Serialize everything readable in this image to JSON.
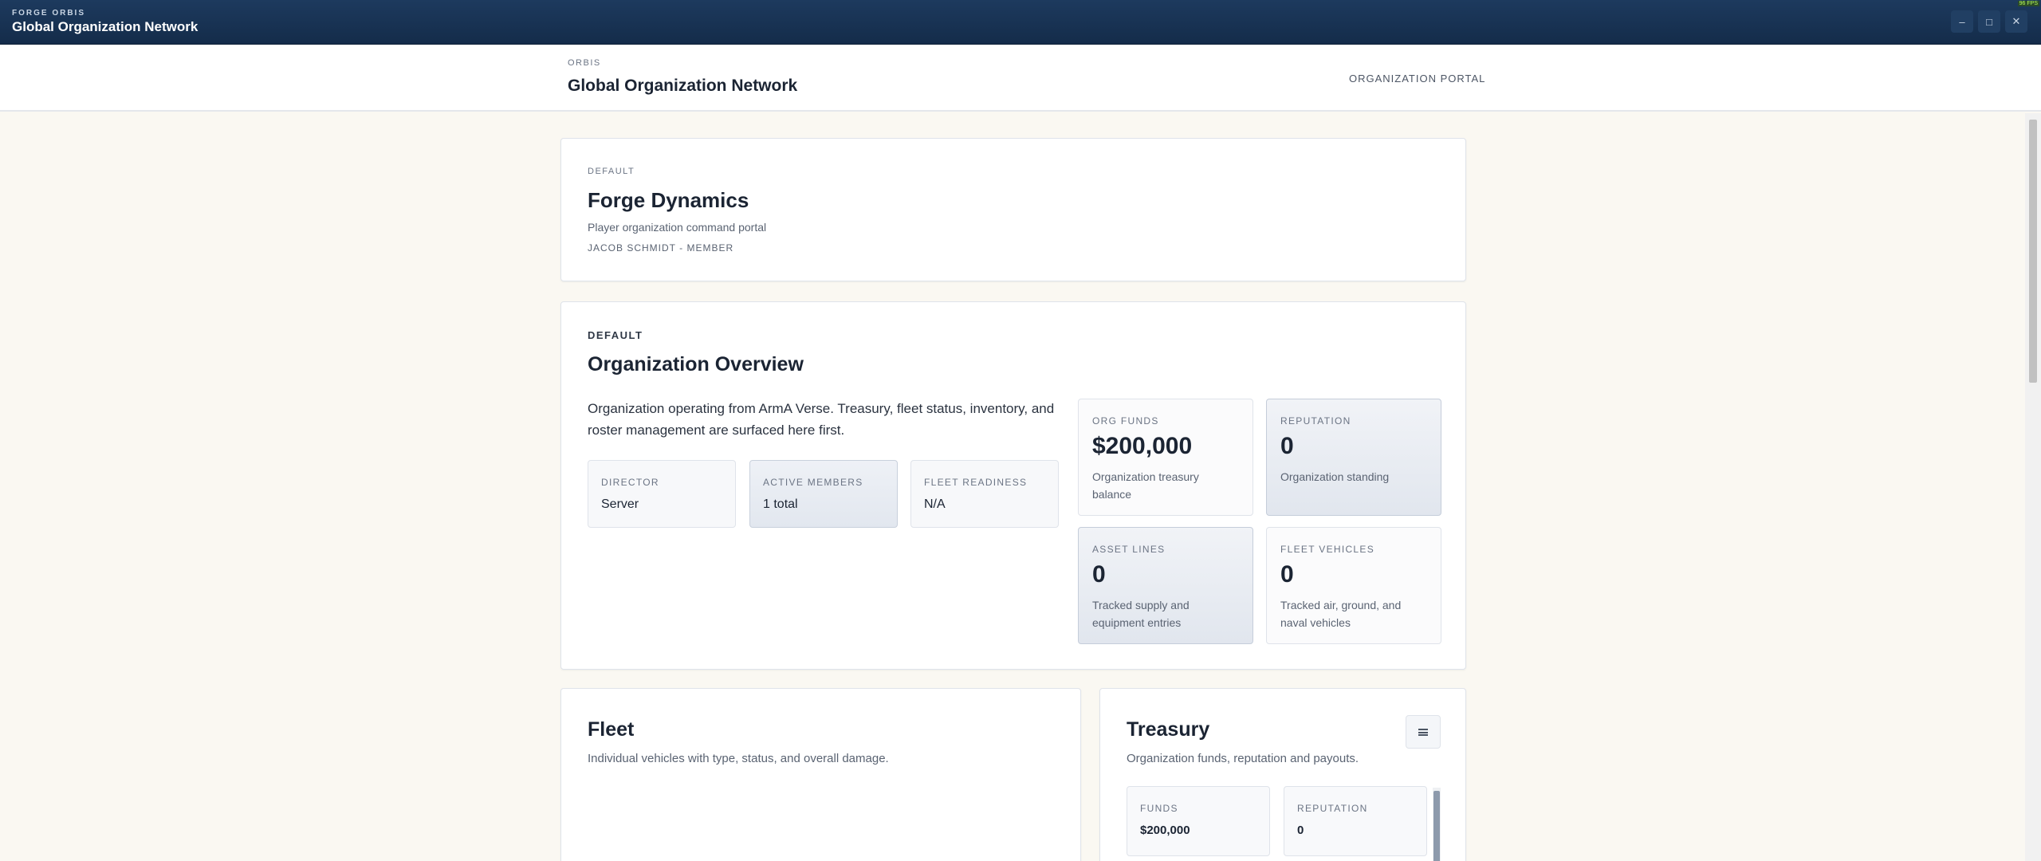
{
  "window": {
    "brand": "FORGE ORBIS",
    "title": "Global Organization Network",
    "badge": "96 FPS"
  },
  "header": {
    "kicker": "ORBIS",
    "title": "Global Organization Network",
    "portal_link": "ORGANIZATION PORTAL"
  },
  "hero": {
    "kicker": "DEFAULT",
    "org_name": "Forge Dynamics",
    "subtitle": "Player organization command portal",
    "user_line": "JACOB SCHMIDT - MEMBER"
  },
  "overview": {
    "kicker": "DEFAULT",
    "title": "Organization Overview",
    "description": "Organization operating from ArmA Verse. Treasury, fleet status, inventory, and roster management are surfaced here first.",
    "mini_stats": [
      {
        "label": "DIRECTOR",
        "value": "Server"
      },
      {
        "label": "ACTIVE MEMBERS",
        "value": "1 total"
      },
      {
        "label": "FLEET READINESS",
        "value": "N/A"
      }
    ],
    "stats": [
      {
        "label": "ORG FUNDS",
        "value": "$200,000",
        "desc": "Organization treasury balance"
      },
      {
        "label": "REPUTATION",
        "value": "0",
        "desc": "Organization standing"
      },
      {
        "label": "ASSET LINES",
        "value": "0",
        "desc": "Tracked supply and equipment entries"
      },
      {
        "label": "FLEET VEHICLES",
        "value": "0",
        "desc": "Tracked air, ground, and naval vehicles"
      }
    ]
  },
  "fleet": {
    "title": "Fleet",
    "subtitle": "Individual vehicles with type, status, and overall damage."
  },
  "treasury": {
    "title": "Treasury",
    "subtitle": "Organization funds, reputation and payouts.",
    "menu_icon": "hamburger-menu-icon",
    "boxes": [
      {
        "label": "FUNDS",
        "value": "$200,000"
      },
      {
        "label": "REPUTATION",
        "value": "0"
      }
    ]
  },
  "window_controls": {
    "minimize": "–",
    "maximize": "□",
    "close": "✕"
  }
}
